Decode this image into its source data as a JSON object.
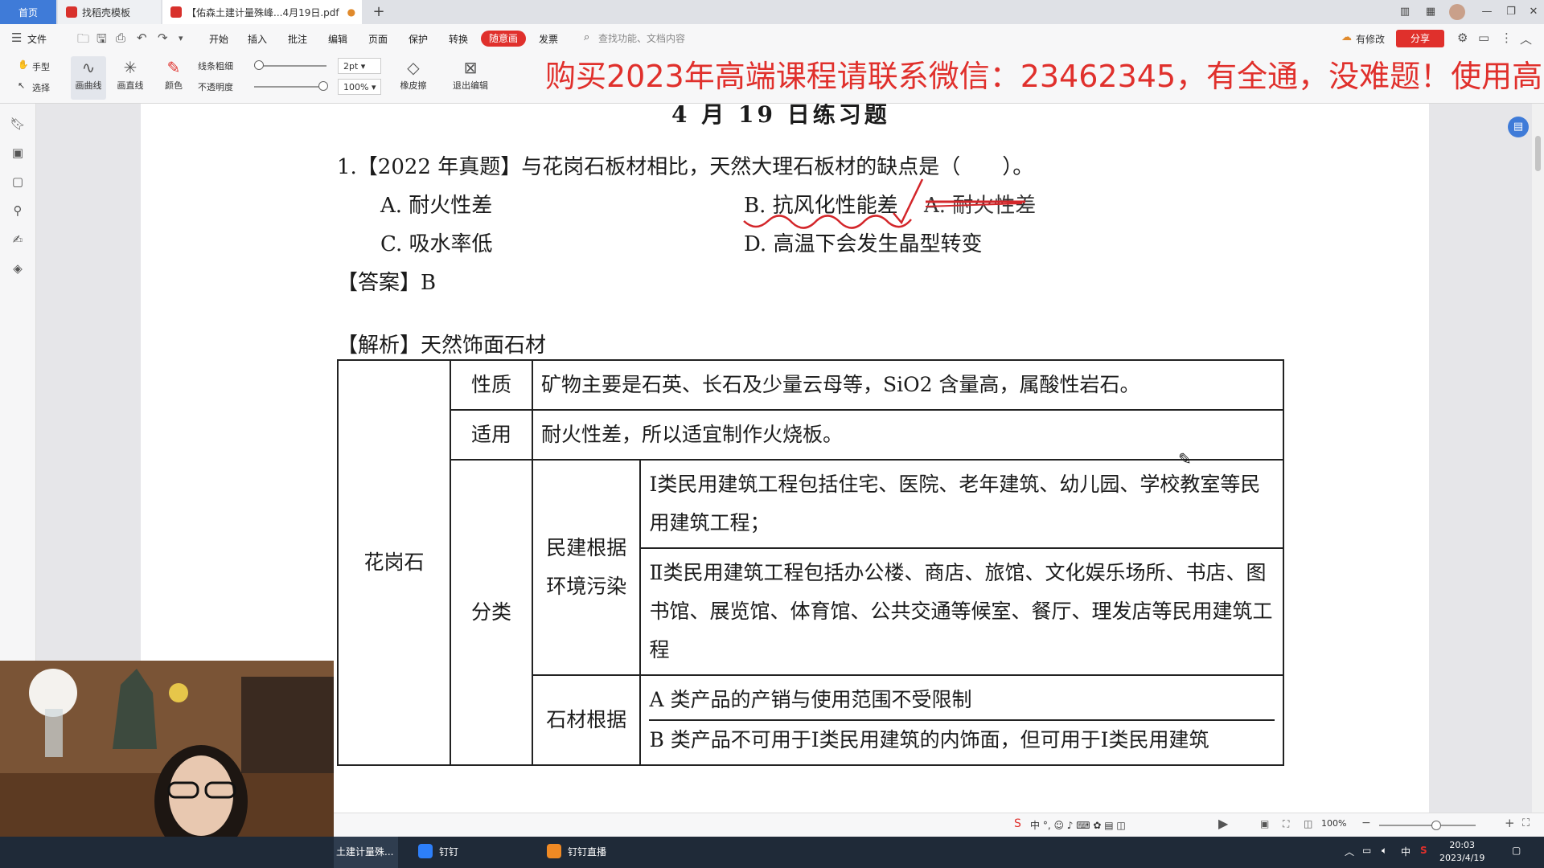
{
  "tabs": {
    "home": "首页",
    "template": "找稻壳模板",
    "pdf": "【佑森土建计量殊峰...4月19日.pdf"
  },
  "menu": {
    "file": "文件",
    "items": [
      "开始",
      "插入",
      "批注",
      "编辑",
      "页面",
      "保护",
      "转换"
    ],
    "special": "随意画",
    "extra": "发票",
    "search_placeholder": "查找功能、文档内容",
    "modified": "有修改",
    "share": "分享"
  },
  "toolbar": {
    "hand": "手型",
    "select": "选择",
    "curve": "画曲线",
    "line": "画直线",
    "color": "颜色",
    "thickness": "线条粗细",
    "opacity": "不透明度",
    "thickness_value": "2pt",
    "opacity_value": "100%",
    "eraser": "橡皮擦",
    "exit": "退出编辑"
  },
  "banner": "购买2023年高端课程请联系微信：23462345，有全通，没难题！使用高",
  "doc": {
    "heading": "4 月 19 日练习题",
    "question": "1.【2022 年真题】与花岗石板材相比，天然大理石板材的缺点是（　　）。",
    "opt_a": "A. 耐火性差",
    "opt_b": "B. 抗风化性能差",
    "opt_c": "C. 吸水率低",
    "opt_d": "D. 高温下会发生晶型转变",
    "handwritten": "A. 耐火性差",
    "answer": "【答案】B",
    "analysis": "【解析】天然饰面石材",
    "table": {
      "stone": "花岗石",
      "prop_label": "性质",
      "prop_text": "矿物主要是石英、长石及少量云母等，SiO2 含量高，属酸性岩石。",
      "use_label": "适用",
      "use_text": "耐火性差，所以适宜制作火烧板。",
      "class_label": "分类",
      "env_label": "民建根据环境污染",
      "env_1": "Ⅰ类民用建筑工程包括住宅、医院、老年建筑、幼儿园、学校教室等民用建筑工程；",
      "env_2": "Ⅱ类民用建筑工程包括办公楼、商店、旅馆、文化娱乐场所、书店、图书馆、展览馆、体育馆、公共交通等候室、餐厅、理发店等民用建筑工程",
      "mat_label": "石材根据",
      "mat_1": "A 类产品的产销与使用范围不受限制",
      "mat_2": "B 类产品不可用于Ⅰ类民用建筑的内饰面，但可用于Ⅰ类民用建筑"
    }
  },
  "status": {
    "zoom": "100%"
  },
  "taskbar": {
    "app1": "土建计量殊...",
    "app2": "钉钉",
    "app3": "钉钉直播",
    "time": "20:03",
    "date": "2023/4/19",
    "ime": "中"
  },
  "colors": {
    "accent_red": "#e0302c",
    "tab_blue": "#3f7bd8"
  }
}
